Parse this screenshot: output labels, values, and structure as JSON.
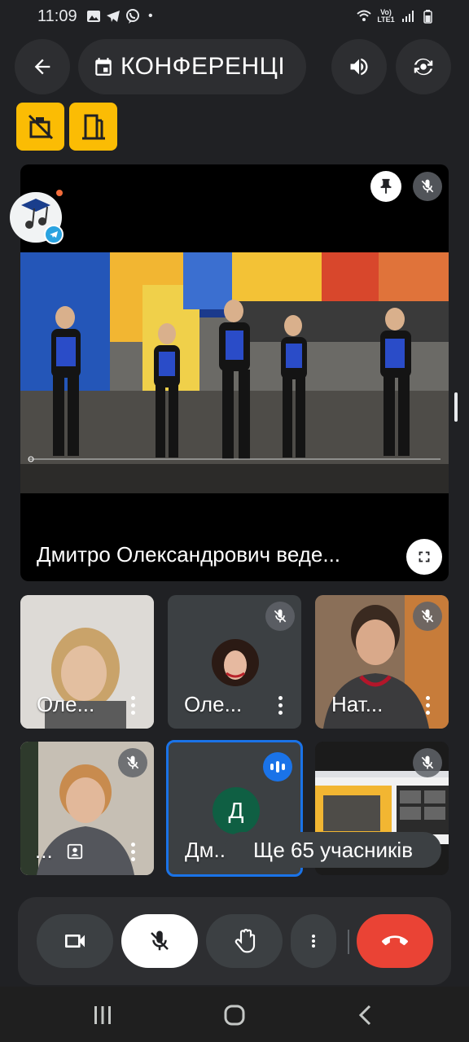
{
  "status_bar": {
    "time": "11:09",
    "dot": "•",
    "network": "Vo) LTE1",
    "icons": [
      "gallery-icon",
      "telegram-icon",
      "viber-icon",
      "wifi-icon",
      "signal-icon",
      "battery-icon"
    ]
  },
  "header": {
    "title": "КОНФЕРЕНЦІ",
    "back": "arrow-back-icon",
    "calendar": "calendar-icon",
    "audio": "speaker-icon",
    "switch_camera": "switch-camera-icon"
  },
  "quick_actions": [
    "no-room-icon",
    "door-icon"
  ],
  "main_tile": {
    "name": "Дмитро Олександрович веде...",
    "pinned": true,
    "muted": true
  },
  "participants": [
    {
      "name": "Оле...",
      "muted": false,
      "type": "video"
    },
    {
      "name": "Оле...",
      "muted": true,
      "type": "photo"
    },
    {
      "name": "Нат...",
      "muted": true,
      "type": "video"
    },
    {
      "name": "...",
      "muted": true,
      "type": "video"
    },
    {
      "name": "Дм...",
      "initial": "Д",
      "speaking": true,
      "type": "avatar"
    },
    {
      "name": "",
      "muted": true,
      "type": "screen"
    }
  ],
  "more_participants": "Ще 65 учасників",
  "controls": {
    "camera": "video-camera-icon",
    "mic": "mic-off-icon",
    "hand": "raise-hand-icon",
    "more": "more-vert-icon",
    "hangup": "call-end-icon"
  },
  "colors": {
    "background": "#202124",
    "accent_yellow": "#fbbc04",
    "hangup_red": "#ea4335",
    "speaking_blue": "#1a73e8"
  }
}
